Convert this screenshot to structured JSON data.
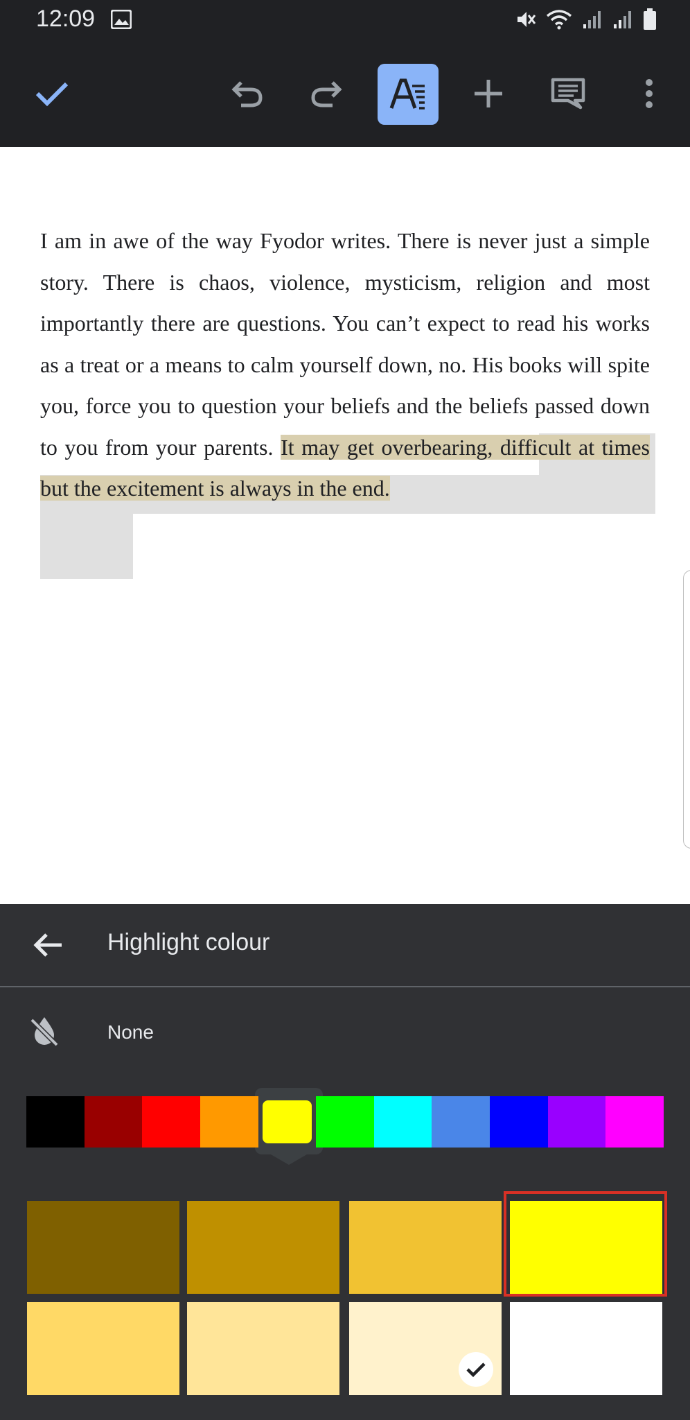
{
  "status_bar": {
    "time": "12:09"
  },
  "icons": {
    "status": [
      "gallery-icon",
      "mute-icon",
      "wifi-icon",
      "signal-icon",
      "signal-icon",
      "battery-icon"
    ],
    "toolbar": [
      "check-icon",
      "undo-icon",
      "redo-icon",
      "text-format-icon",
      "add-icon",
      "comment-icon",
      "more-vert-icon"
    ],
    "panel": [
      "arrow-back-icon",
      "no-highlight-icon",
      "checkmark-icon"
    ]
  },
  "document": {
    "text_before": "I am in awe of the way Fyodor writes. There is never just a simple story. There is chaos, violence, mysticism, religion and most importantly there are questions. You can’t expect to read his works as a treat or a means to calm yourself down, no. His books will spite you, force you to question your beliefs and the beliefs passed down to you from your parents. ",
    "text_highlighted": "It may get overbearing, difficult at times but the excitement is always in the end."
  },
  "panel": {
    "title": "Highlight colour",
    "none_label": "None"
  },
  "colors": {
    "hues": [
      "#000000",
      "#990000",
      "#ff0000",
      "#ff9900",
      "#ffff00",
      "#00ff00",
      "#00ffff",
      "#4a86e8",
      "#0000ff",
      "#9900ff",
      "#ff00ff"
    ],
    "selected_hue_index": 4,
    "shades_row1": [
      "#7f6000",
      "#bf9000",
      "#f1c232",
      "#ffff00"
    ],
    "shades_row2": [
      "#ffd966",
      "#ffe599",
      "#fff2cc",
      "#ffffff"
    ],
    "checked_shade": "row2-3",
    "highlighted_shade": "row1-4",
    "toolbar_active": "#8ab4f8",
    "accent": "#8ab4f8"
  }
}
